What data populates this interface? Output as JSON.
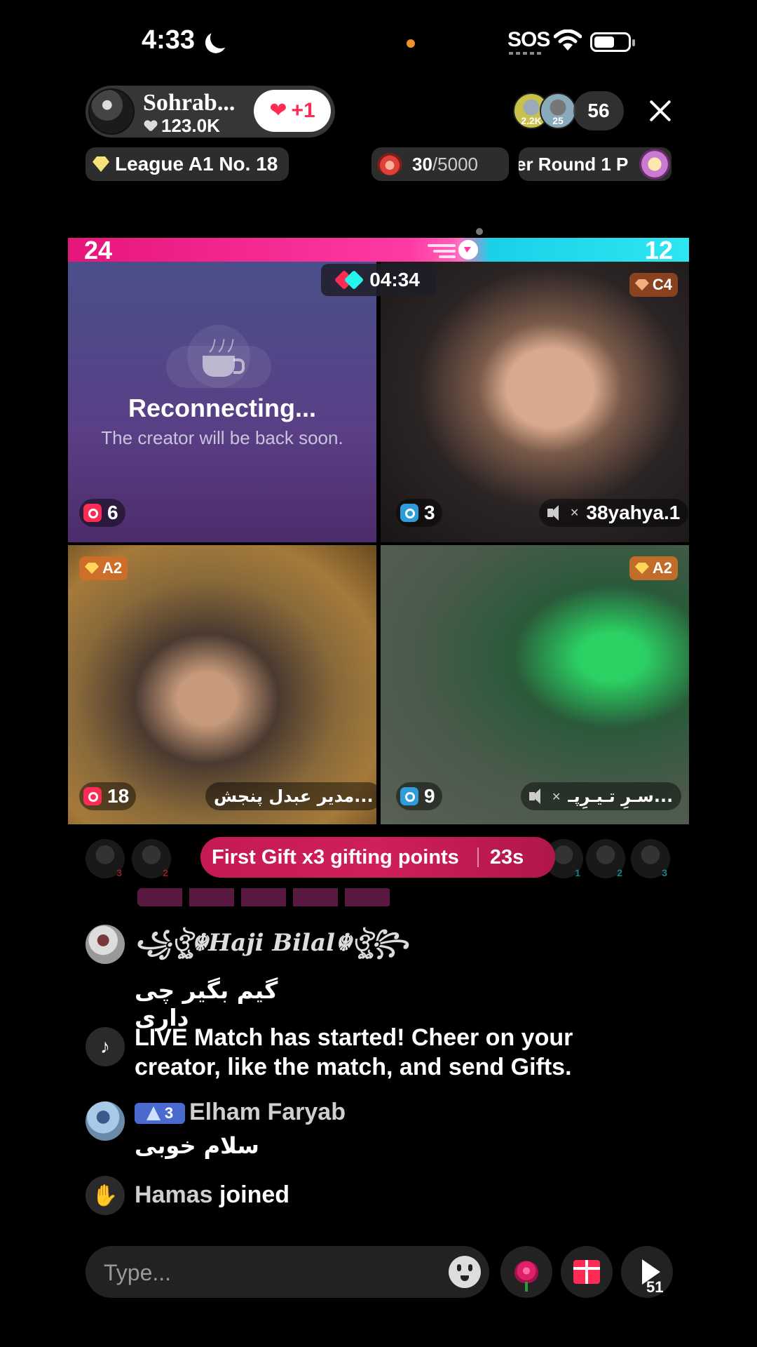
{
  "status_bar": {
    "time": "4:33",
    "sos": "SOS"
  },
  "host": {
    "name": "Sohrab...",
    "likes": "123.0K",
    "follow_label": "+1"
  },
  "viewers": {
    "avatars": [
      {
        "label": "2.2K"
      },
      {
        "label": "25"
      }
    ],
    "count": "56"
  },
  "league": {
    "label": "League A1 No. 18"
  },
  "goal": {
    "current": "30",
    "total": "/5000"
  },
  "round": {
    "label": "er Round 1   P"
  },
  "battle": {
    "score_left": "24",
    "score_right": "12",
    "timer": "04:34"
  },
  "tiles": [
    {
      "reconnect_title": "Reconnecting...",
      "reconnect_sub": "The creator will be back soon.",
      "gift_count": "6"
    },
    {
      "rank": "C4",
      "gift_count": "3",
      "username": "38yahya.1"
    },
    {
      "rank": "A2",
      "gift_count": "18",
      "username": "مدیر عبدل پنجش..."
    },
    {
      "rank": "A2",
      "gift_count": "9",
      "username": "سـرِ تـیـرِپـ..."
    }
  ],
  "gifters": {
    "left_ranks": [
      "3",
      "2"
    ],
    "right_ranks": [
      "1",
      "2",
      "3"
    ]
  },
  "promo": {
    "text": "First Gift x3 gifting points",
    "countdown": "23s"
  },
  "comments": [
    {
      "name": "꧁ঔৣ☬Haji Bilal☬ঔৣ꧂",
      "text": "گیم بگیر چی داری"
    },
    {
      "system": "LIVE Match has started! Cheer on your creator, like the match, and send Gifts."
    },
    {
      "level": "3",
      "name": "Elham Faryab",
      "text": "سلام خوبی"
    },
    {
      "name": "Hamas",
      "action": "joined"
    }
  ],
  "composer": {
    "placeholder": "Type...",
    "share_count": "51"
  },
  "colors": {
    "accent_pink": "#fe2c55",
    "accent_cyan": "#25f4ee",
    "promo": "#c41a55"
  }
}
